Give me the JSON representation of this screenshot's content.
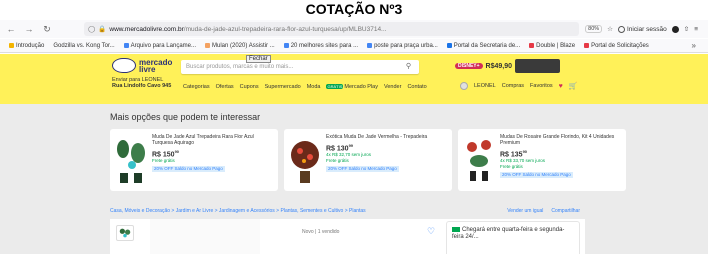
{
  "document": {
    "title": "COTAÇÃO Nº3"
  },
  "browser": {
    "url_host": "www.mercadolivre.com.br",
    "url_path": "/muda-de-jade-azul-trepadeira-rara-flor-azul-turquesa/up/MLBU3714...",
    "zoom": "80%",
    "sync_label": "Iniciar sessão",
    "bookmarks": [
      {
        "label": "Introdução",
        "color": "#f4b400"
      },
      {
        "label": "Godzilla vs. Kong Tor...",
        "color": "#ffffff"
      },
      {
        "label": "Arquivo para Lançame...",
        "color": "#4285f4"
      },
      {
        "label": "Mulan (2020) Assistir ...",
        "color": "#f4a261"
      },
      {
        "label": "20 melhores sites para ...",
        "color": "#4285f4"
      },
      {
        "label": "poste para praça urba...",
        "color": "#4285f4"
      },
      {
        "label": "Portal da Secretaria de...",
        "color": "#1a73e8"
      },
      {
        "label": "Double | Blaze",
        "color": "#e63946"
      },
      {
        "label": "Portal de Solicitações",
        "color": "#e63946"
      }
    ]
  },
  "ml": {
    "logo_line1": "mercado",
    "logo_line2": "livre",
    "search_placeholder": "Buscar produtos, marcas e muito mais...",
    "tooltip": "Fechar",
    "promo_pill": "DISNEY+",
    "promo_price": "R$49,90",
    "location_line1": "Enviar para LEONEL",
    "location_line2": "Rua Lindolfo Cavo 945",
    "nav": [
      "Categorias",
      "Ofertas",
      "Cupons",
      "Supermercado",
      "Moda",
      "Mercado Play",
      "Vender",
      "Contato"
    ],
    "nav_badge": "GRÁTIS",
    "user_name": "LEONEL",
    "user_links": [
      "Compras",
      "Favoritos"
    ]
  },
  "content": {
    "section_title": "Mais opções que podem te interessar",
    "cards": [
      {
        "title": "Muda De Jade Azul Trepadeira Rara Flor Azul Turquesa Aquirago",
        "price": "R$ 150",
        "cents": "90",
        "installment": "",
        "shipping": "Frete grátis",
        "discount": "20% OFF Saldo no Mercado Pago",
        "img_color": "#2f6b3a"
      },
      {
        "title": "Exótica Muda De Jade Vermelha - Trepadeira",
        "price": "R$ 130",
        "cents": "99",
        "installment": "4x R$ 32,70 sem juros",
        "shipping": "Frete grátis",
        "discount": "20% OFF Saldo no Mercado Pago",
        "img_color": "#8b3a2a"
      },
      {
        "title": "Mudas De Rosaire Grande Florindo, Kit 4 Unidades Premium",
        "price": "R$ 135",
        "cents": "90",
        "installment": "4x R$ 33,70 sem juros",
        "shipping": "Frete grátis",
        "discount": "20% OFF Saldo no Mercado Pago",
        "img_color": "#c0392b"
      }
    ],
    "breadcrumb": "Casa, Móveis e Decoração > Jardim e Ar Livre > Jardinagem e Acessórios > Plantas, Sementes e Cultivo > Plantas",
    "breadcrumb_right": [
      "Vender um igual",
      "Compartilhar"
    ],
    "sold": "Novo | 1 vendido",
    "delivery": "Chegará entre quarta-feira e segunda-feira 24/..."
  }
}
